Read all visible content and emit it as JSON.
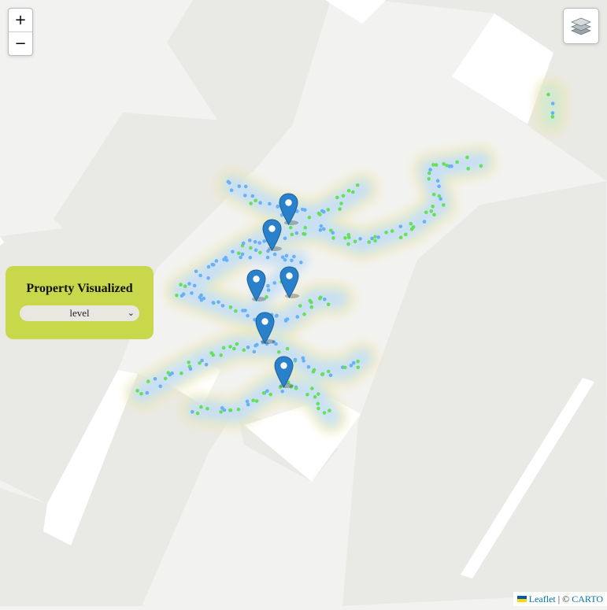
{
  "controls": {
    "zoom_in": "+",
    "zoom_out": "−",
    "layers_icon": "layers-icon"
  },
  "property_panel": {
    "title": "Property Visualized",
    "selected": "level",
    "options": [
      "level"
    ]
  },
  "attribution": {
    "leaflet": "Leaflet",
    "separator": " | © ",
    "carto": "CARTO"
  },
  "colors": {
    "map_bg": "#f2f2f0",
    "building": "#e9e9e6",
    "building_light": "#ffffff",
    "panel": "#c8d84a",
    "marker": "#2a81cb",
    "point_blue": "#6ab0f5",
    "point_green": "#66e05a"
  },
  "markers_count": 6
}
